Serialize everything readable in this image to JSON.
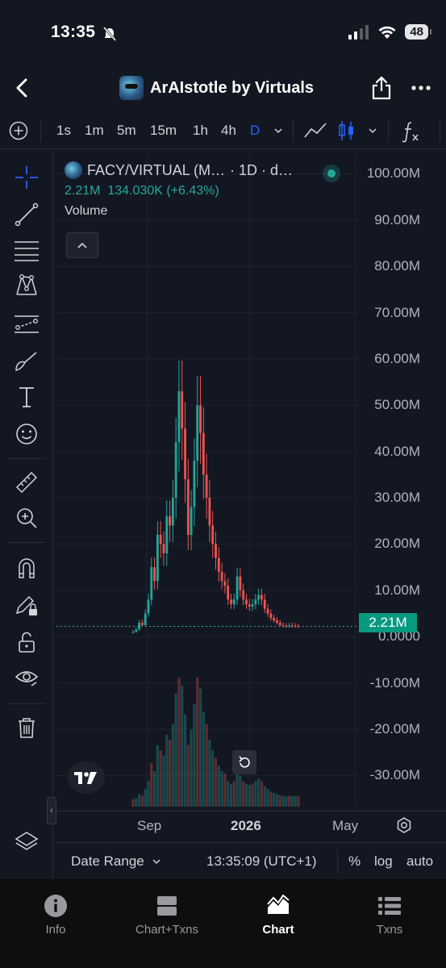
{
  "status": {
    "time": "13:35",
    "battery": "48"
  },
  "nav": {
    "title": "ArAIstotle by Virtuals"
  },
  "toolbar": {
    "intervals": [
      "1s",
      "1m",
      "5m",
      "15m",
      "1h",
      "4h",
      "D"
    ],
    "active_interval": "D"
  },
  "legend": {
    "symbol": "FACY/VIRTUAL (M…",
    "interval": "· 1D · d…",
    "value": "2.21M",
    "change": "134.030K (+6.43%)",
    "volume_label": "Volume"
  },
  "chart_data": {
    "type": "candlestick",
    "y_ticks": [
      "100.00M",
      "90.00M",
      "80.00M",
      "70.00M",
      "60.00M",
      "50.00M",
      "40.00M",
      "30.00M",
      "20.00M",
      "10.00M",
      "0.0000",
      "-10.00M",
      "-20.00M",
      "-30.00M"
    ],
    "ylim": [
      -35000000,
      102000000
    ],
    "x_ticks": [
      "Sep",
      "2026",
      "May"
    ],
    "last_price_label": "2.21M",
    "last_price": 2210000,
    "up_color": "#26a69a",
    "down_color": "#ef5350",
    "close_series_millions": [
      1,
      1.5,
      3,
      2.5,
      5,
      8,
      15,
      12,
      22,
      20,
      18,
      26,
      24,
      30,
      42,
      53,
      45,
      34,
      22,
      28,
      38,
      50,
      44,
      35,
      30,
      24,
      20,
      17,
      14,
      12,
      11,
      8,
      7,
      8,
      13,
      10,
      8,
      7,
      6.5,
      7,
      8,
      9,
      8,
      6,
      5,
      4,
      3.5,
      3,
      2.5,
      2.3,
      2.2,
      2.4,
      2.3,
      2.25,
      2.21
    ]
  },
  "bottom": {
    "date_range": "Date Range",
    "time": "13:35:09 (UTC+1)",
    "percent": "%",
    "log": "log",
    "auto": "auto"
  },
  "tabs": [
    {
      "label": "Info",
      "icon": "info-icon"
    },
    {
      "label": "Chart+Txns",
      "icon": "split-view-icon"
    },
    {
      "label": "Chart",
      "icon": "chart-icon"
    },
    {
      "label": "Txns",
      "icon": "list-icon"
    }
  ],
  "active_tab": "Chart"
}
